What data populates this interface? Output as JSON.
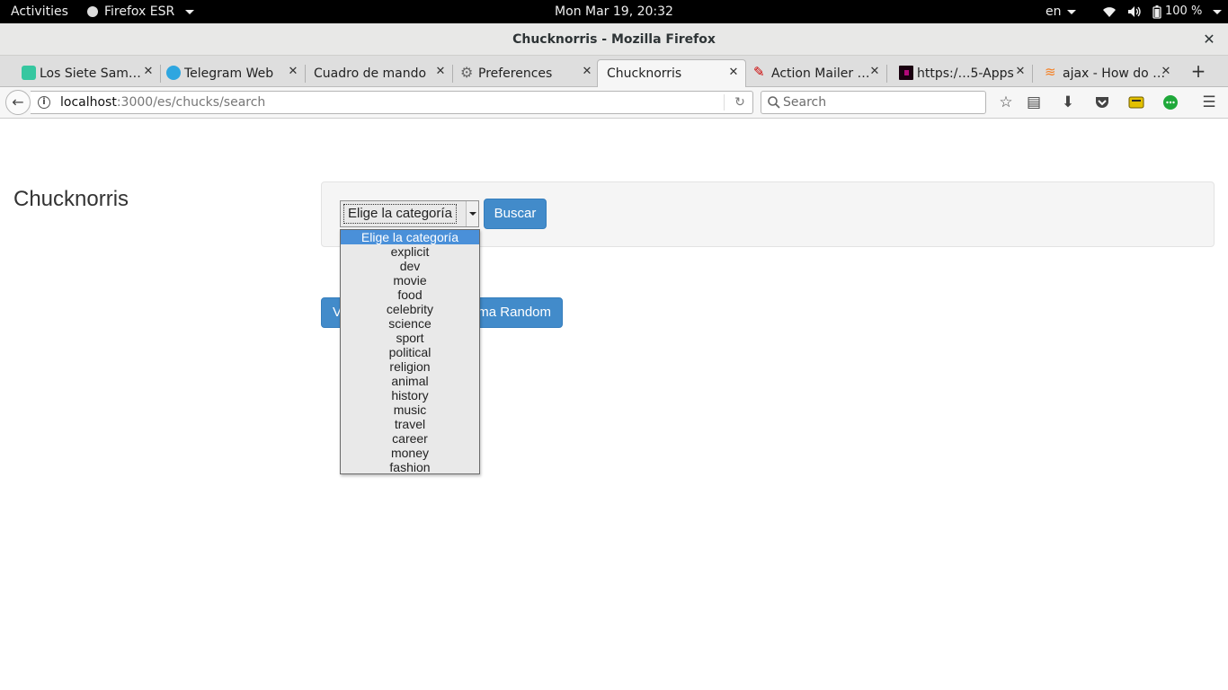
{
  "system_bar": {
    "activities": "Activities",
    "app_name": "Firefox ESR",
    "clock": "Mon Mar 19, 20:32",
    "language": "en",
    "battery": "100 %"
  },
  "window": {
    "title": "Chucknorris - Mozilla Firefox"
  },
  "tabs": [
    {
      "label": "Los Siete Sam…",
      "icon": "character-icon",
      "color": "#36c7a0"
    },
    {
      "label": "Telegram Web",
      "icon": "telegram-icon",
      "color": "#2ea6e0"
    },
    {
      "label": "Cuadro de mando",
      "icon": "",
      "color": ""
    },
    {
      "label": "Preferences",
      "icon": "gear-icon",
      "color": "#666666"
    },
    {
      "label": "Chucknorris",
      "icon": "",
      "color": "",
      "active": true
    },
    {
      "label": "Action Mailer …",
      "icon": "rails-icon",
      "color": "#cc0000"
    },
    {
      "label": "https:/…5-Apps",
      "icon": "app-icon",
      "color": "#b4087a"
    },
    {
      "label": "ajax - How do …",
      "icon": "stackoverflow-icon",
      "color": "#f48024"
    }
  ],
  "nav": {
    "url_host": "localhost",
    "url_path": ":3000/es/chucks/search",
    "search_placeholder": "Search"
  },
  "page": {
    "brand": "Chucknorris",
    "select_value": "Elige la categoría",
    "search_button": "Buscar",
    "random_button_lead": "V",
    "random_button_tail": "ma Random",
    "options": [
      "Elige la categoría",
      "explicit",
      "dev",
      "movie",
      "food",
      "celebrity",
      "science",
      "sport",
      "political",
      "religion",
      "animal",
      "history",
      "music",
      "travel",
      "career",
      "money",
      "fashion"
    ],
    "selected_option_index": 0
  },
  "colors": {
    "primary_button": "#428bca",
    "selected_option": "#4a90d9"
  }
}
